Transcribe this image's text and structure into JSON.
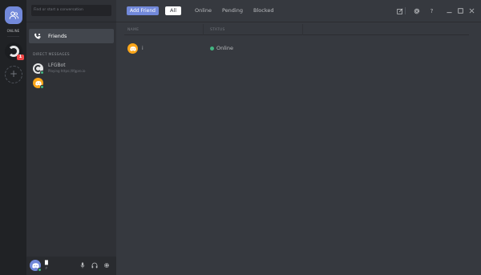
{
  "rail": {
    "home_label": "ONLINE",
    "badge": "1"
  },
  "channels": {
    "search_placeholder": "Find or start a conversation",
    "friends_label": "Friends",
    "dm_header": "DIRECT MESSAGES",
    "dms": [
      {
        "name": "LFGBot",
        "activity": "Playing https://lfgpro.io",
        "avatar": "bot"
      },
      {
        "name": "",
        "activity": "",
        "avatar": "orange"
      }
    ]
  },
  "user_panel": {
    "username": "█",
    "tag": "#"
  },
  "topbar": {
    "add_friend": "Add Friend",
    "tabs": [
      "All",
      "Online",
      "Pending",
      "Blocked"
    ],
    "active_tab": "All"
  },
  "table": {
    "columns": [
      "NAME",
      "STATUS"
    ],
    "rows": [
      {
        "name": "i",
        "status": "Online"
      }
    ]
  },
  "colors": {
    "accent": "#7289da",
    "online": "#43b581",
    "badge": "#f04747",
    "orange_avatar": "#faa61a"
  }
}
